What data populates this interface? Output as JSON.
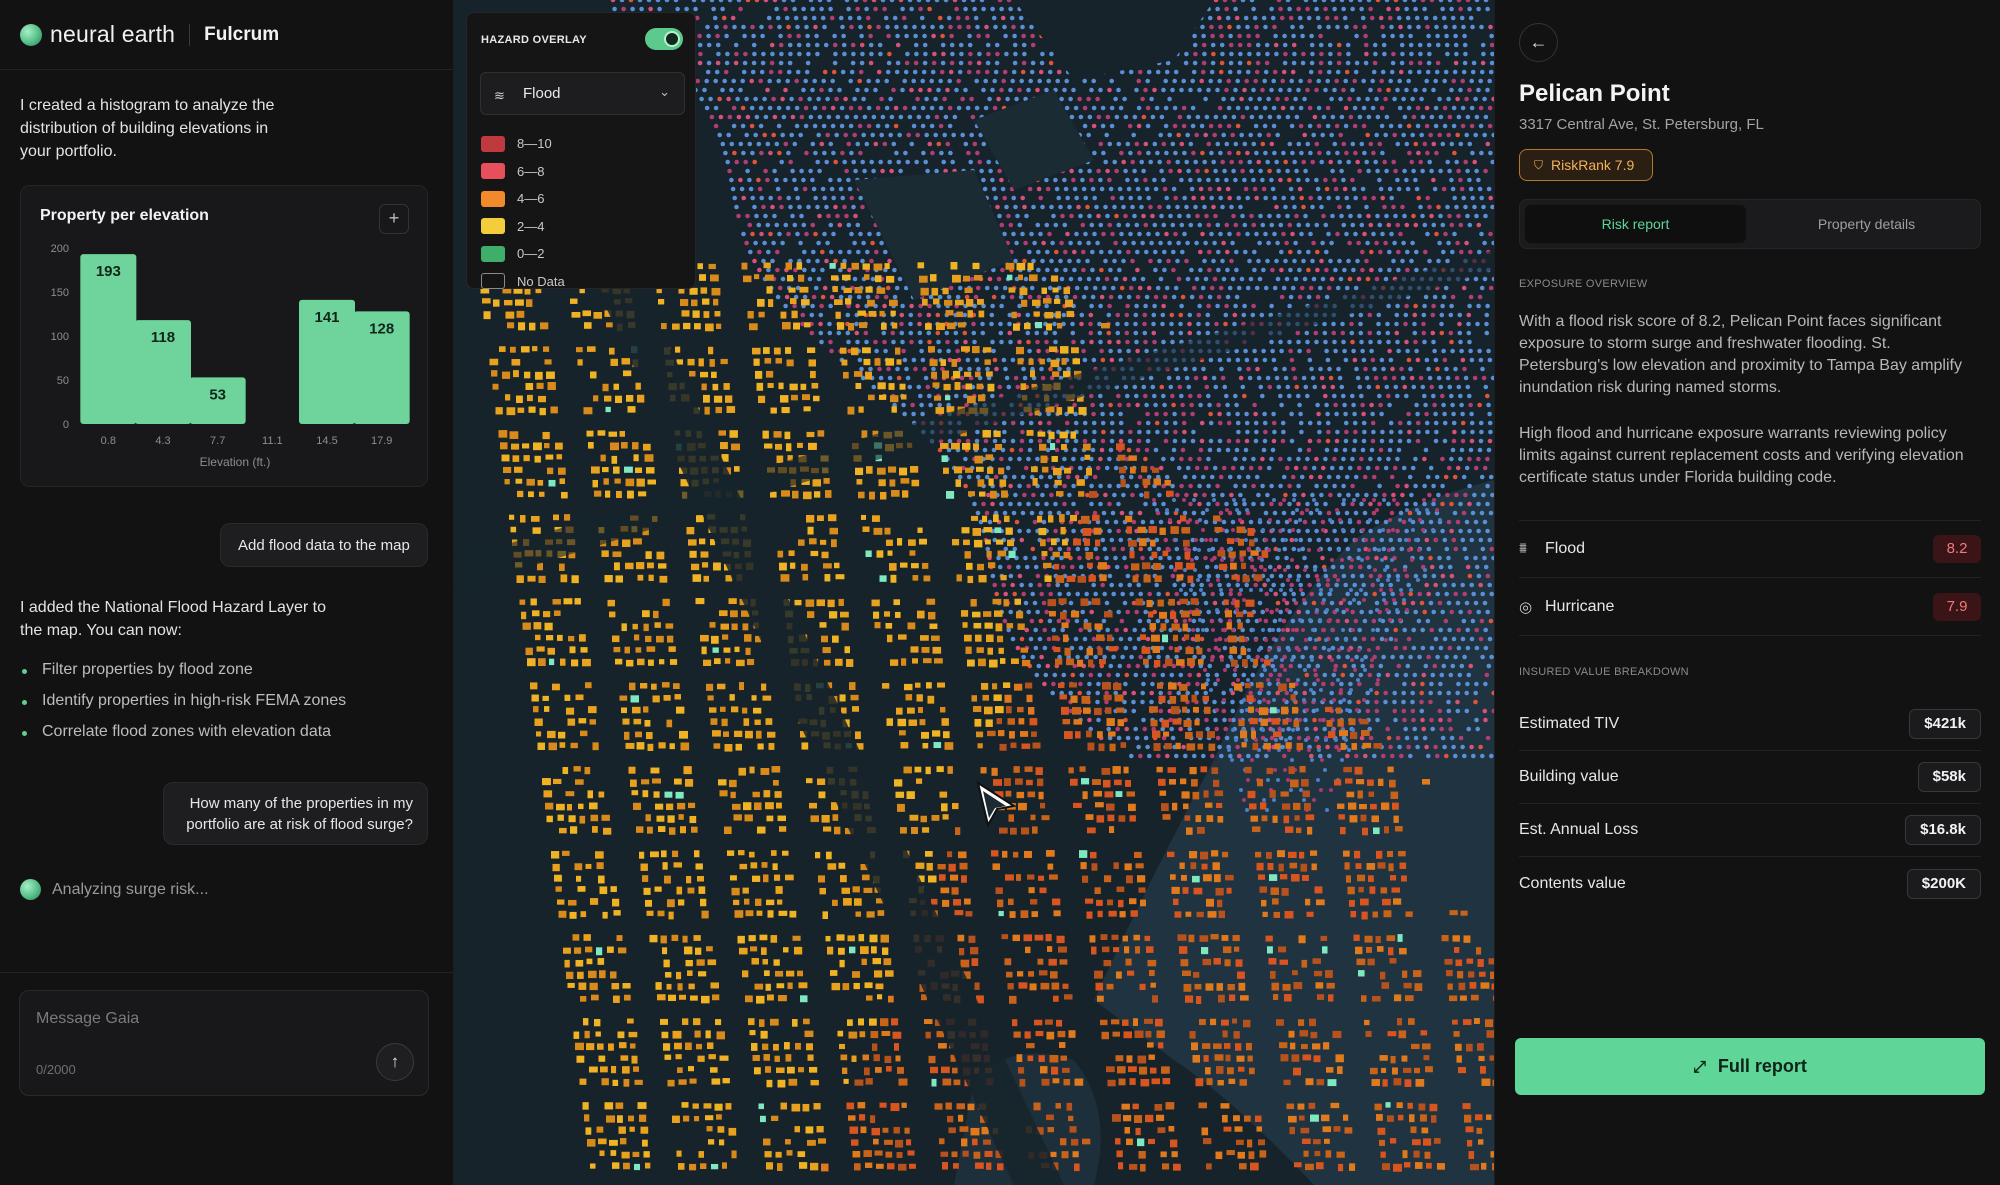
{
  "brand": {
    "name": "neural earth",
    "product": "Fulcrum"
  },
  "chat": {
    "assistant_intro": "I created a histogram to analyze the distribution of building elevations in your portfolio.",
    "user_msg1": "Add flood data to the map",
    "assistant_followup": "I added the National Flood Hazard Layer to the map. You can now:",
    "bullets": [
      "Filter properties by flood zone",
      "Identify properties in high-risk FEMA zones",
      "Correlate flood zones with elevation data"
    ],
    "user_msg2": "How many of the properties in my portfolio are at risk of flood surge?",
    "status": "Analyzing surge risk...",
    "composer": {
      "placeholder": "Message Gaia",
      "count": "0/2000",
      "send_icon": "arrow-up-icon"
    }
  },
  "chart_data": {
    "type": "bar",
    "title": "Property per elevation",
    "categories": [
      "0.8",
      "4.3",
      "7.7",
      "11.1",
      "14.5",
      "17.9"
    ],
    "values": [
      193,
      118,
      53,
      0,
      141,
      128
    ],
    "xlabel": "Elevation (ft.)",
    "ylabel": "",
    "ylim": [
      0,
      200
    ],
    "yticks": [
      0,
      50,
      100,
      150,
      200
    ],
    "bar_color": "#6fd49b"
  },
  "map": {
    "hazard": {
      "title": "HAZARD OVERLAY",
      "enabled": true,
      "selected": "Flood",
      "legend": [
        {
          "label": "8—10",
          "color": "#c0393f"
        },
        {
          "label": "6—8",
          "color": "#e5505a"
        },
        {
          "label": "4—6",
          "color": "#f08a2a"
        },
        {
          "label": "2—4",
          "color": "#f3cd3c"
        },
        {
          "label": "0—2",
          "color": "#3fae6a"
        },
        {
          "label": "No Data",
          "color": "transparent"
        }
      ]
    }
  },
  "detail": {
    "name": "Pelican Point",
    "address": "3317 Central Ave, St. Petersburg, FL",
    "riskrank": "RiskRank 7.9",
    "tabs": [
      "Risk report",
      "Property details"
    ],
    "exposure_label": "EXPOSURE OVERVIEW",
    "exposure_p1": "With a flood risk score of 8.2, Pelican Point faces significant exposure to storm surge and freshwater flooding. St. Petersburg's low elevation and proximity to Tampa Bay amplify inundation risk during named storms.",
    "exposure_p2": "High flood and hurricane exposure warrants reviewing policy limits against current replacement costs and verifying elevation certificate status under Florida building code.",
    "hazards": [
      {
        "label": "Flood",
        "score": "8.2",
        "icon": "flood-icon"
      },
      {
        "label": "Hurricane",
        "score": "7.9",
        "icon": "hurricane-icon"
      }
    ],
    "insured_label": "INSURED VALUE BREAKDOWN",
    "values": [
      {
        "label": "Estimated TIV",
        "value": "$421k"
      },
      {
        "label": "Building value",
        "value": "$58k"
      },
      {
        "label": "Est. Annual Loss",
        "value": "$16.8k"
      },
      {
        "label": "Contents value",
        "value": "$200K"
      }
    ],
    "full_report": "Full report"
  },
  "colors": {
    "accent": "#5fd597",
    "danger": "#f07a7a",
    "warning": "#f3b05c"
  }
}
